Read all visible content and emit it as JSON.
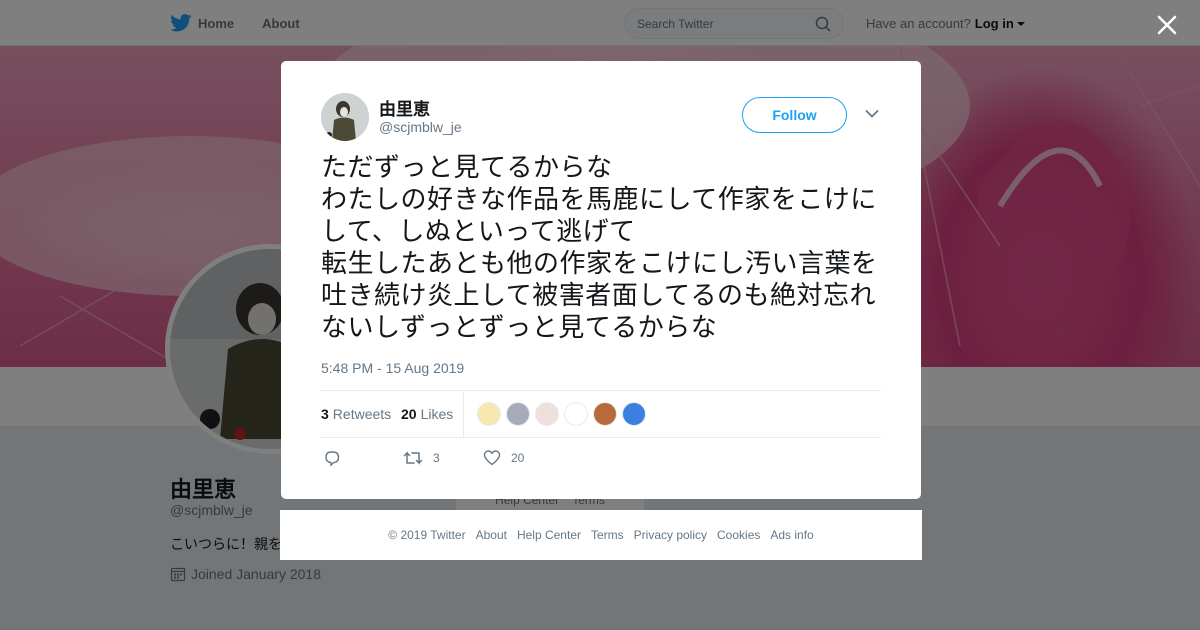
{
  "topbar": {
    "home_label": "Home",
    "about_label": "About",
    "search_placeholder": "Search Twitter",
    "account_prompt": "Have an account?",
    "login_label": "Log in",
    "brand_color": "#1da1f2"
  },
  "profile": {
    "name": "由里恵",
    "handle": "@scjmblw_je",
    "bio": "こいつらに！親を",
    "joined": "Joined January 2018"
  },
  "background_footer": {
    "help_center": "Help Center",
    "terms": "Terms"
  },
  "tweet": {
    "author_name": "由里恵",
    "author_handle": "@scjmblw_je",
    "follow_label": "Follow",
    "text": "ただずっと見てるからな\nわたしの好きな作品を馬鹿にして作家をこけにして、しぬといって逃げて\n転生したあとも他の作家をこけにし汚い言葉を吐き続け炎上して被害者面してるのも絶対忘れないしずっとずっと見てるからな",
    "timestamp": "5:48 PM - 15 Aug 2019",
    "retweets_count": "3",
    "retweets_label": "Retweets",
    "likes_count": "20",
    "likes_label": "Likes",
    "reply_count": "",
    "retweet_action_count": "3",
    "like_action_count": "20",
    "likers": [
      {
        "color": "#f6e8b0"
      },
      {
        "color": "#a7aab8"
      },
      {
        "color": "#efe0dc"
      },
      {
        "color": "#ffffff"
      },
      {
        "color": "#b86a3a"
      },
      {
        "color": "#3b7fe0"
      }
    ]
  },
  "footer": {
    "copyright": "© 2019 Twitter",
    "about": "About",
    "help_center": "Help Center",
    "terms": "Terms",
    "privacy": "Privacy policy",
    "cookies": "Cookies",
    "ads_info": "Ads info"
  }
}
